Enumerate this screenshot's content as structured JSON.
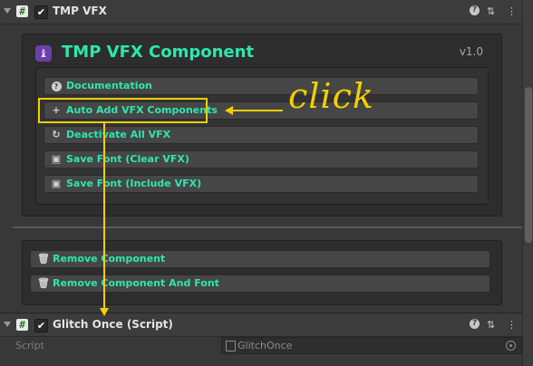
{
  "header_top": {
    "title": "TMP VFX",
    "enabled": true
  },
  "component": {
    "title": "TMP VFX Component",
    "version": "v1.0",
    "buttons": [
      {
        "label": "Documentation",
        "icon": "help-icon"
      },
      {
        "label": "Auto Add VFX Components",
        "icon": "plus-icon"
      },
      {
        "label": "Deactivate All VFX",
        "icon": "refresh-icon"
      },
      {
        "label": "Save Font (Clear VFX)",
        "icon": "save-icon"
      },
      {
        "label": "Save Font (Include VFX)",
        "icon": "save-icon"
      }
    ]
  },
  "danger_buttons": [
    {
      "label": "Remove Component",
      "icon": "trash-icon"
    },
    {
      "label": "Remove Component And Font",
      "icon": "trash-icon"
    }
  ],
  "header_bottom": {
    "title": "Glitch Once (Script)",
    "enabled": true
  },
  "script_property": {
    "label": "Script",
    "value": "GlitchOnce"
  },
  "annotation": {
    "text": "click"
  },
  "colors": {
    "accent": "#2ee6b0",
    "annotation": "#f2cf00",
    "background": "#383838",
    "panel": "#2d2d2d"
  }
}
